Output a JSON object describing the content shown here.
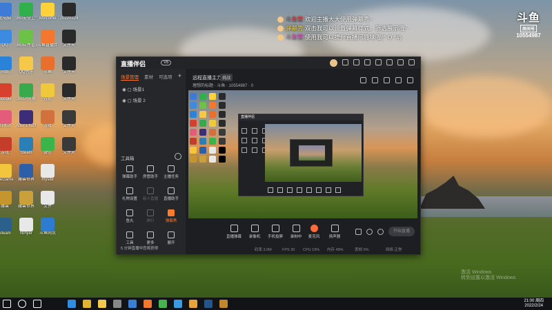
{
  "danmu": [
    {
      "nick": "斗鱼管",
      "text": "欢迎主播大大使用弹幕秀~"
    },
    {
      "nick": "弹幕秀",
      "text": "双击我可以设置弹幕样式，筛选展示哦~"
    },
    {
      "nick": "斗鱼管",
      "text": "使用我可以提升直播间趣味哦(^ O ^#)"
    }
  ],
  "douyu": {
    "logo": "斗鱼",
    "room_label": "房间号",
    "room_id": "10554987"
  },
  "desktop_icons": [
    {
      "label": "此电脑",
      "color": "#3e7bd6"
    },
    {
      "label": "360安全卫士",
      "color": "#2fb04b"
    },
    {
      "label": "Welcome",
      "color": "#ffd23a"
    },
    {
      "label": "20220224",
      "color": "#2a2a2a"
    },
    {
      "label": "QQ",
      "color": "#3d8be0"
    },
    {
      "label": "360软件管家",
      "color": "#6cc246"
    },
    {
      "label": "斗鱼直播伴侣",
      "color": "#f3772c"
    },
    {
      "label": "文件夹",
      "color": "#2a2a2a"
    },
    {
      "label": "网络",
      "color": "#2b82d9"
    },
    {
      "label": "QQ音乐",
      "color": "#f5c84a"
    },
    {
      "label": "斗鱼",
      "color": "#e96f2d"
    },
    {
      "label": "文件夹",
      "color": "#2a2a2a"
    },
    {
      "label": "Google",
      "color": "#d8402e"
    },
    {
      "label": "360浏览器",
      "color": "#39a94d"
    },
    {
      "label": "谷歌",
      "color": "#f0c83c"
    },
    {
      "label": "文件夹",
      "color": "#2a2a2a"
    },
    {
      "label": "回收站",
      "color": "#e35d7a"
    },
    {
      "label": "After Effects",
      "color": "#3c2d78"
    },
    {
      "label": "游戏",
      "color": "#d1723e"
    },
    {
      "label": "文件夹",
      "color": "#3a3a3a"
    },
    {
      "label": "游戏",
      "color": "#c43c2a"
    },
    {
      "label": "Steam",
      "color": "#2a7fb6"
    },
    {
      "label": "微信",
      "color": "#39b54a"
    },
    {
      "label": "文件夹",
      "color": "#3a3a3a"
    },
    {
      "label": "WeGame",
      "color": "#f1c53c"
    },
    {
      "label": "魔兽世界",
      "color": "#2c5fa8"
    },
    {
      "label": "mysite",
      "color": "#e8e8e8"
    },
    {
      "label": "",
      "color": "#000000"
    },
    {
      "label": "魔兽",
      "color": "#c5962e"
    },
    {
      "label": "魔兽世界",
      "color": "#caa03a"
    },
    {
      "label": "文件",
      "color": "#e8e8e8"
    },
    {
      "label": "",
      "color": "#000000"
    },
    {
      "label": "Steam",
      "color": "#2b5f8c"
    },
    {
      "label": "NPlyer",
      "color": "#e8e8e8"
    },
    {
      "label": "斗鱼网页",
      "color": "#2e7bd2"
    },
    {
      "label": "",
      "color": "#000000"
    }
  ],
  "app": {
    "brand": "直播伴侣",
    "version": "V6",
    "left_tabs": [
      "场景管理",
      "素材",
      "可选项"
    ],
    "scenes": [
      "场景1",
      "场景 2"
    ],
    "tools_title": "工具箱",
    "tools": [
      {
        "label": "弹幕助手"
      },
      {
        "label": "房管助手"
      },
      {
        "label": "主播任务"
      },
      {
        "label": "礼物设置"
      },
      {
        "label": "新人直播"
      },
      {
        "label": "直播助手"
      },
      {
        "label": "鱼丸"
      },
      {
        "label": "排行"
      },
      {
        "label": "弹幕秀"
      },
      {
        "label": "工具"
      },
      {
        "label": "更多"
      },
      {
        "label": "展开"
      }
    ],
    "footer_note": "5 分钟直播中您将获得",
    "stream_title": "远程直播主力",
    "category": "挑战",
    "stream_sub": "理想的标题 · 斗鱼 · 10554987 · 0",
    "bottom_buttons": [
      "直播弹幕",
      "录像机",
      "手机投屏",
      "录制中",
      "麦克风",
      "扬声器"
    ],
    "go_live": "开始直播",
    "status": [
      "码率 3.0M",
      "FPS 30",
      "CPU 19%",
      "内存 48%",
      "丢帧 0%",
      "网络 正常"
    ]
  },
  "clock": {
    "time": "21:00 周四",
    "date": "2022/2/24"
  },
  "watermark": {
    "line1": "激活 Windows",
    "line2": "转到设置以激活 Windows"
  },
  "taskbar_icons": [
    {
      "name": "start-icon",
      "color": "#ffffff"
    },
    {
      "name": "search-icon",
      "color": "#ffffff"
    },
    {
      "name": "taskview-icon",
      "color": "#ffffff"
    },
    {
      "name": "edge-icon",
      "color": "#2f8ee0"
    },
    {
      "name": "chrome-icon",
      "color": "#e0b431"
    },
    {
      "name": "explorer-icon",
      "color": "#f2c94c"
    },
    {
      "name": "calc-icon",
      "color": "#888888"
    },
    {
      "name": "store-icon",
      "color": "#3a7fd6"
    },
    {
      "name": "douyu-icon",
      "color": "#f3772c"
    },
    {
      "name": "wechat-icon",
      "color": "#46b54d"
    },
    {
      "name": "qq-icon",
      "color": "#3a9be0"
    },
    {
      "name": "browser-icon",
      "color": "#e8a43a"
    },
    {
      "name": "steam-icon",
      "color": "#24558a"
    },
    {
      "name": "game-icon",
      "color": "#c1882c"
    }
  ]
}
